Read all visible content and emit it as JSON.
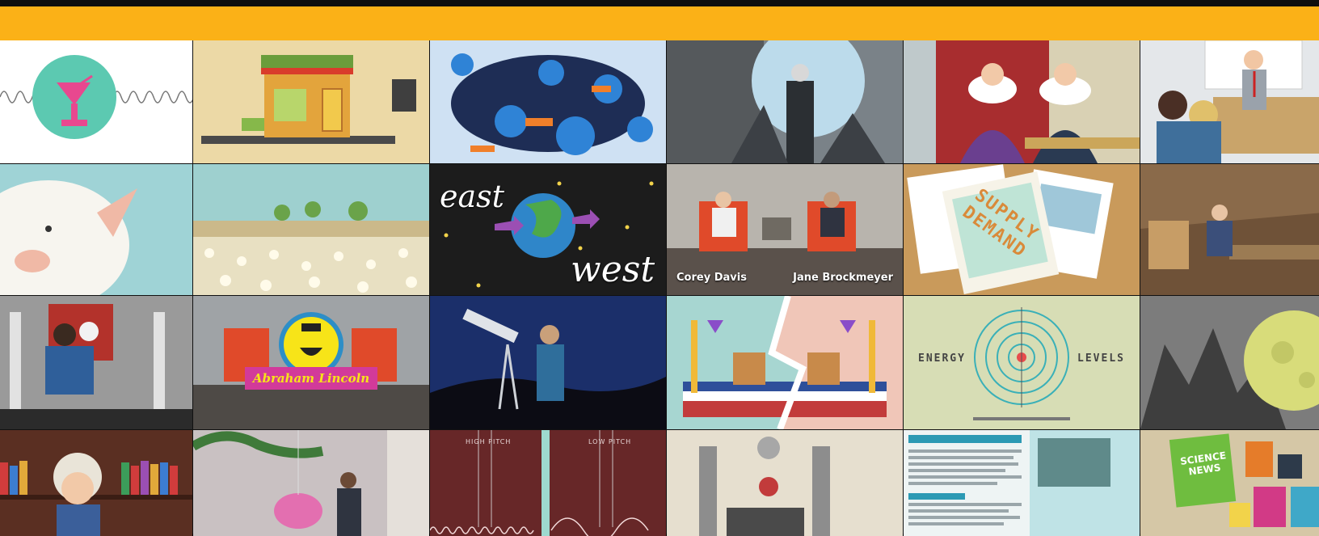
{
  "colors": {
    "banner": "#fbb117",
    "banner_edge": "#0e0e0e"
  },
  "tiles": {
    "east_west": {
      "word_top": "east",
      "word_bottom": "west"
    },
    "talk_show": {
      "left_name": "Corey Davis",
      "right_name": "Jane Brockmeyer"
    },
    "supply_demand": {
      "line1": "SUPPLY",
      "line2": "DEMAND"
    },
    "lincoln": {
      "banner_text": "Abraham Lincoln"
    },
    "energy_levels": {
      "left_word": "ENERGY",
      "right_word": "LEVELS"
    },
    "pitch": {
      "left_label": "HIGH PITCH",
      "right_label": "LOW PITCH"
    },
    "science_news": {
      "line1": "SCIENCE",
      "line2": "NEWS"
    }
  }
}
